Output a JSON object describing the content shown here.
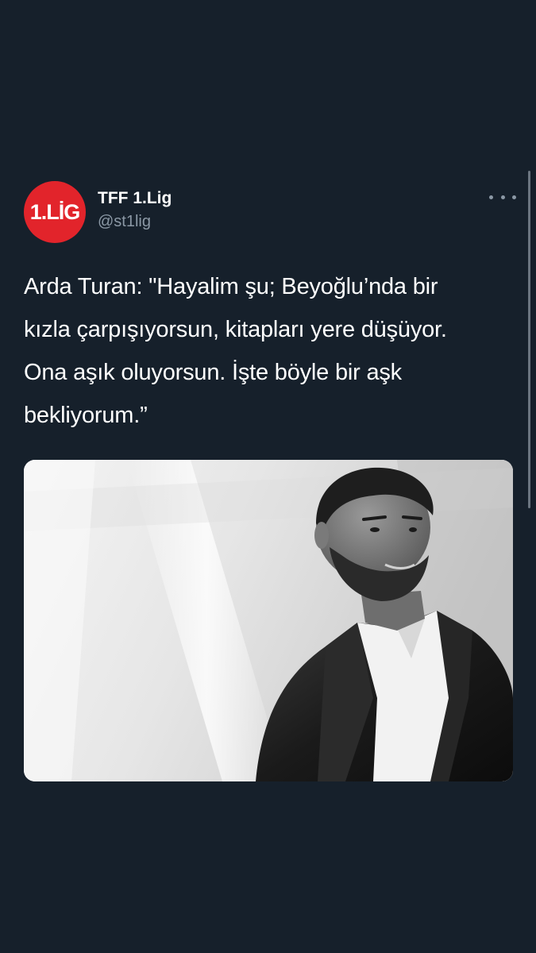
{
  "account": {
    "avatar_text": "1.LİG",
    "display_name": "TFF 1.Lig",
    "handle": "@st1lig",
    "avatar_color": "#e2242b"
  },
  "tweet": {
    "text_lines": [
      "Arda Turan: \"Hayalim şu; Beyoğlu’nda bir",
      "kızla çarpışıyorsun, kitapları yere düşüyor.",
      "Ona aşık oluyorsun. İşte böyle bir aşk",
      "bekliyorum.”"
    ],
    "media_icon": "photo-black-and-white-man-leather-jacket"
  },
  "icons": {
    "more": "more-horizontal-icon"
  },
  "colors": {
    "background": "#16202b",
    "text": "#ffffff",
    "secondary_text": "#8b98a5"
  }
}
